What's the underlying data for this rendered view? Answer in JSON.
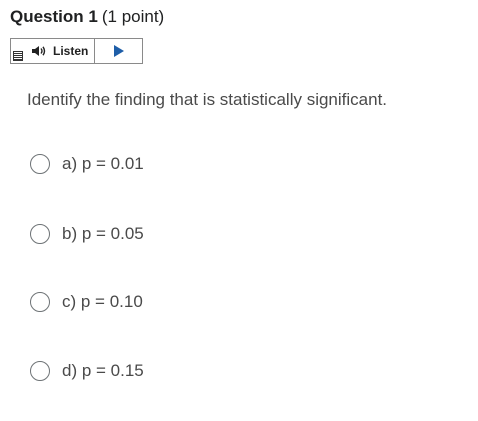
{
  "header": {
    "title": "Question 1",
    "points": "(1 point)"
  },
  "listen_toolbar": {
    "listen_label": "Listen",
    "icons": {
      "menu": "menu-icon",
      "speaker": "speaker-icon",
      "play": "play-icon"
    }
  },
  "question": {
    "text": "Identify the finding that is statistically significant."
  },
  "options": [
    {
      "label": "a) p = 0.01",
      "selected": false
    },
    {
      "label": "b) p = 0.05",
      "selected": false
    },
    {
      "label": "c) p = 0.10",
      "selected": false
    },
    {
      "label": "d) p = 0.15",
      "selected": false
    }
  ],
  "colors": {
    "text_primary": "#202122",
    "text_secondary": "#4a4a4a",
    "border": "#8a8a8a",
    "play_blue": "#1e5ea8"
  }
}
